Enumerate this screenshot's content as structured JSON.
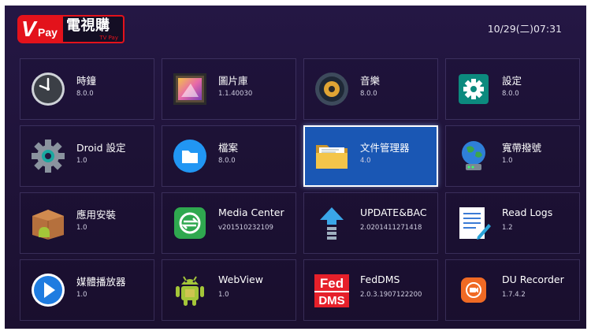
{
  "header": {
    "logo_tv": "V",
    "logo_pay": "Pay",
    "logo_cn": "電視購",
    "logo_sub": "TV Pay",
    "clock": "10/29(二)07:31"
  },
  "apps": [
    {
      "name": "時鐘",
      "version": "8.0.0",
      "icon": "clock-icon"
    },
    {
      "name": "圖片庫",
      "version": "1.1.40030",
      "icon": "gallery-icon"
    },
    {
      "name": "音樂",
      "version": "8.0.0",
      "icon": "music-speaker-icon"
    },
    {
      "name": "設定",
      "version": "8.0.0",
      "icon": "settings-gear-icon"
    },
    {
      "name": "Droid 設定",
      "version": "1.0",
      "icon": "gear-icon"
    },
    {
      "name": "檔案",
      "version": "8.0.0",
      "icon": "folder-icon"
    },
    {
      "name": "文件管理器",
      "version": "4.0",
      "icon": "file-manager-folder-icon",
      "selected": true
    },
    {
      "name": "寬帶撥號",
      "version": "1.0",
      "icon": "globe-network-icon"
    },
    {
      "name": "應用安裝",
      "version": "1.0",
      "icon": "apk-box-icon"
    },
    {
      "name": "Media Center",
      "version": "v201510232109",
      "icon": "media-center-icon"
    },
    {
      "name": "UPDATE&BAC",
      "version": "2.0201411271418",
      "icon": "update-arrow-icon"
    },
    {
      "name": "Read Logs",
      "version": "1.2",
      "icon": "notepad-icon"
    },
    {
      "name": "媒體播放器",
      "version": "1.0",
      "icon": "play-icon"
    },
    {
      "name": "WebView",
      "version": "1.0",
      "icon": "android-robot-icon"
    },
    {
      "name": "FedDMS",
      "version": "2.0.3.1907122200",
      "icon": "feddms-icon"
    },
    {
      "name": "DU Recorder",
      "version": "1.7.4.2",
      "icon": "screen-recorder-icon"
    }
  ],
  "icon_labels": {
    "fed": "Fed",
    "dms": "DMS"
  },
  "colors": {
    "background": "#231642",
    "selected_tile": "#1a57b4",
    "logo_red": "#e3121b"
  }
}
